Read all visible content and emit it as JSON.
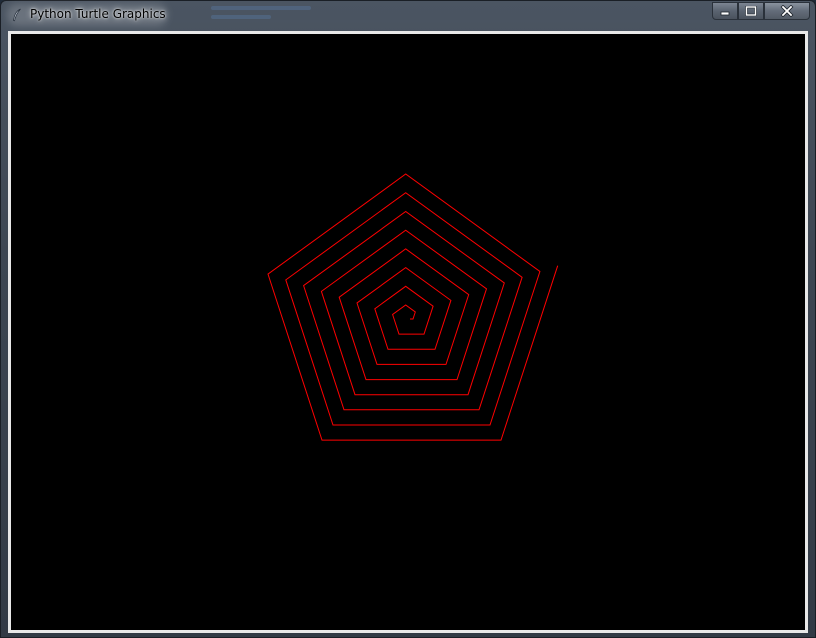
{
  "window": {
    "title": "Python Turtle Graphics",
    "icon": "feather-icon"
  },
  "controls": {
    "minimize_icon": "minimize-icon",
    "maximize_icon": "maximize-icon",
    "close_icon": "close-icon"
  },
  "canvas": {
    "background": "#000000",
    "pen_color": "#ff0000",
    "shape": "pentagon-spiral"
  }
}
